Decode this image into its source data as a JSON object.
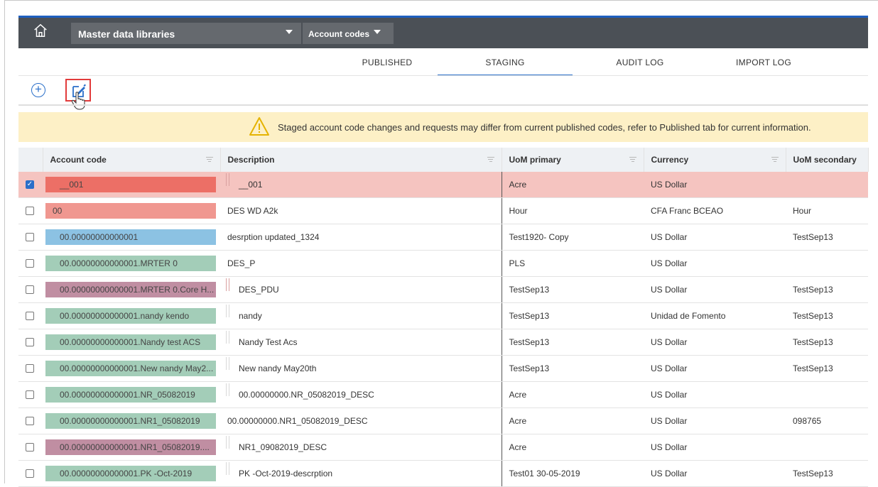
{
  "header": {
    "library_select": "Master data libraries",
    "type_select": "Account codes"
  },
  "tabs": [
    {
      "label": "PUBLISHED"
    },
    {
      "label": "STAGING"
    },
    {
      "label": "AUDIT LOG"
    },
    {
      "label": "IMPORT LOG"
    }
  ],
  "banner": {
    "message": "Staged account code changes and requests may differ from current published codes, refer to Published tab for current information."
  },
  "table": {
    "columns": [
      "Account code",
      "Description",
      "UoM primary",
      "Currency",
      "UoM secondary"
    ],
    "rows": [
      {
        "code": "__001",
        "description": "__001",
        "uom_primary": "Acre",
        "currency": "US Dollar",
        "uom_secondary": ""
      },
      {
        "code": "00",
        "description": "DES WD A2k",
        "uom_primary": "Hour",
        "currency": "CFA Franc BCEAO",
        "uom_secondary": "Hour"
      },
      {
        "code": "00.00000000000001",
        "description": "desrption updated_1324",
        "uom_primary": "Test1920- Copy",
        "currency": "US Dollar",
        "uom_secondary": "TestSep13"
      },
      {
        "code": "00.00000000000001.MRTER 0",
        "description": "DES_P",
        "uom_primary": "PLS",
        "currency": "US Dollar",
        "uom_secondary": ""
      },
      {
        "code": "00.00000000000001.MRTER 0.Core H...",
        "description": "DES_PDU",
        "uom_primary": "TestSep13",
        "currency": "US Dollar",
        "uom_secondary": "TestSep13"
      },
      {
        "code": "00.00000000000001.nandy kendo",
        "description": "nandy",
        "uom_primary": "TestSep13",
        "currency": "Unidad de Fomento",
        "uom_secondary": "TestSep13"
      },
      {
        "code": "00.00000000000001.Nandy test ACS",
        "description": "Nandy Test Acs",
        "uom_primary": "TestSep13",
        "currency": "US Dollar",
        "uom_secondary": "TestSep13"
      },
      {
        "code": "00.00000000000001.New nandy May2...",
        "description": "New nandy May20th",
        "uom_primary": "TestSep13",
        "currency": "US Dollar",
        "uom_secondary": "TestSep13"
      },
      {
        "code": "00.00000000000001.NR_05082019",
        "description": "00.00000000.NR_05082019_DESC",
        "uom_primary": "Acre",
        "currency": "US Dollar",
        "uom_secondary": ""
      },
      {
        "code": "00.00000000000001.NR1_05082019",
        "description": "00.00000000.NR1_05082019_DESC",
        "uom_primary": "Acre",
        "currency": "US Dollar",
        "uom_secondary": "098765"
      },
      {
        "code": "00.00000000000001.NR1_05082019....",
        "description": "NR1_09082019_DESC",
        "uom_primary": "Acre",
        "currency": "US Dollar",
        "uom_secondary": ""
      },
      {
        "code": "00.00000000000001.PK -Oct-2019",
        "description": "PK -Oct-2019-descrption",
        "uom_primary": "Test01 30-05-2019",
        "currency": "US Dollar",
        "uom_secondary": "TestSep13"
      }
    ]
  },
  "colors": {
    "topbar": "#4b5056",
    "accent_blue": "#2a6fc9",
    "code_red": "#ec6f66",
    "code_salmon": "#f09790",
    "code_blue": "#8cc2e3",
    "code_green": "#a3cdb8",
    "code_mauve": "#c08ea2",
    "selected_row": "#f5c4c0",
    "banner": "#fdf0c6"
  },
  "icons": [
    "home-icon",
    "add-icon",
    "edit-icon",
    "warning-icon",
    "filter-icon",
    "checkbox-icon",
    "pointer-cursor-icon"
  ]
}
